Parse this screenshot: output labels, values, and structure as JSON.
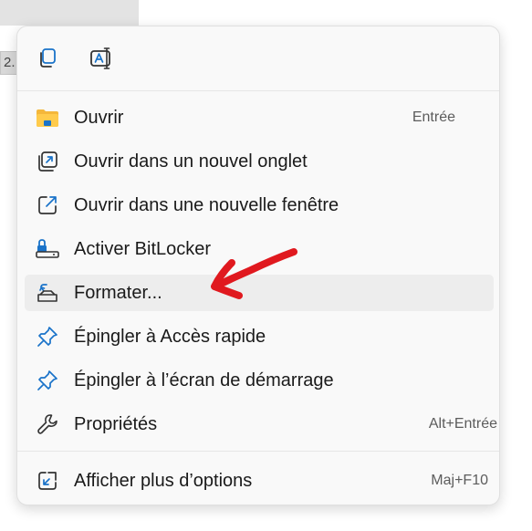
{
  "background": {
    "cell_text": "2."
  },
  "toolbar": {
    "copy_icon": "copy-icon",
    "rename_icon": "rename-icon"
  },
  "menu": {
    "items": [
      {
        "label": "Ouvrir",
        "shortcut": "Entrée",
        "icon": "folder-icon"
      },
      {
        "label": "Ouvrir dans un nouvel onglet",
        "shortcut": "",
        "icon": "new-tab-icon"
      },
      {
        "label": "Ouvrir dans une nouvelle fenêtre",
        "shortcut": "",
        "icon": "new-window-icon"
      },
      {
        "label": "Activer BitLocker",
        "shortcut": "",
        "icon": "bitlocker-icon"
      },
      {
        "label": "Formater...",
        "shortcut": "",
        "icon": "format-icon"
      },
      {
        "label": "Épingler à Accès rapide",
        "shortcut": "",
        "icon": "pin-icon"
      },
      {
        "label": "Épingler à l’écran de démarrage",
        "shortcut": "",
        "icon": "pin-icon"
      },
      {
        "label": "Propriétés",
        "shortcut": "Alt+Entrée",
        "icon": "wrench-icon"
      },
      {
        "label": "Afficher plus d’options",
        "shortcut": "Maj+F10",
        "icon": "more-options-icon"
      }
    ]
  },
  "colors": {
    "menu_bg": "#f9f9f9",
    "hover_bg": "#ededed",
    "accent_blue": "#1a73c9",
    "folder_yellow": "#f4b73b",
    "annotation_red": "#e0191f"
  }
}
